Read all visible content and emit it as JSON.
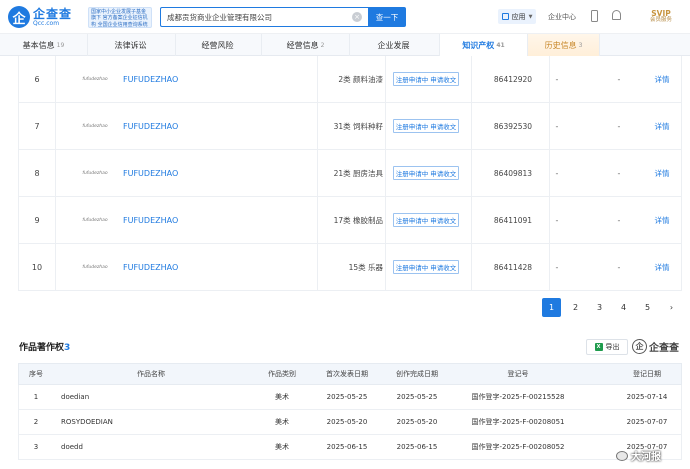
{
  "header": {
    "logo_cn": "企查查",
    "logo_en": "Qcc.com",
    "slogan": "国家中小企业发展子基金旗下 官方备案企业征信机构 全国企业信用查询系统",
    "search_value": "成都贡货商业企业管理有限公司",
    "search_button": "查一下",
    "app_label": "应用",
    "enterprise_center": "企业中心",
    "svip_title": "SVIP",
    "svip_subtitle": "会员服务"
  },
  "tabs": [
    {
      "label": "基本信息",
      "count": "19"
    },
    {
      "label": "法律诉讼",
      "count": ""
    },
    {
      "label": "经营风险",
      "count": ""
    },
    {
      "label": "经营信息",
      "count": "2"
    },
    {
      "label": "企业发展",
      "count": ""
    },
    {
      "label": "知识产权",
      "count": "41"
    },
    {
      "label": "历史信息",
      "count": "3"
    }
  ],
  "trademarks": [
    {
      "no": "6",
      "image_text": "fufudezhao",
      "name": "FUFUDEZHAO",
      "class": "2类 颜料油漆",
      "status": "注册申请中 申请收文",
      "reg_no": "86412920",
      "d1": "-",
      "d2": "-",
      "detail": "详情"
    },
    {
      "no": "7",
      "image_text": "fufudezhao",
      "name": "FUFUDEZHAO",
      "class": "31类 饲料种籽",
      "status": "注册申请中 申请收文",
      "reg_no": "86392530",
      "d1": "-",
      "d2": "-",
      "detail": "详情"
    },
    {
      "no": "8",
      "image_text": "fufudezhao",
      "name": "FUFUDEZHAO",
      "class": "21类 厨房洁具",
      "status": "注册申请中 申请收文",
      "reg_no": "86409813",
      "d1": "-",
      "d2": "-",
      "detail": "详情"
    },
    {
      "no": "9",
      "image_text": "fufudezhao",
      "name": "FUFUDEZHAO",
      "class": "17类 橡胶制品",
      "status": "注册申请中 申请收文",
      "reg_no": "86411091",
      "d1": "-",
      "d2": "-",
      "detail": "详情"
    },
    {
      "no": "10",
      "image_text": "fufudezhao",
      "name": "FUFUDEZHAO",
      "class": "15类 乐器",
      "status": "注册申请中 申请收文",
      "reg_no": "86411428",
      "d1": "-",
      "d2": "-",
      "detail": "详情"
    }
  ],
  "pagination": {
    "pages": [
      "1",
      "2",
      "3",
      "4",
      "5"
    ],
    "current": "1",
    "next": "›"
  },
  "copyright_section": {
    "title": "作品著作权",
    "count": "3",
    "export_label": "导出",
    "brand": "企查查"
  },
  "copyright_table": {
    "headers": {
      "no": "序号",
      "name": "作品名称",
      "type": "作品类别",
      "first": "首次发表日期",
      "done": "创作完成日期",
      "reg": "登记号",
      "date": "登记日期"
    },
    "rows": [
      {
        "no": "1",
        "name": "doedian",
        "type": "美术",
        "first": "2025-05-25",
        "done": "2025-05-25",
        "reg": "国作登字-2025-F-00215528",
        "date": "2025-07-14"
      },
      {
        "no": "2",
        "name": "ROSYDOEDIAN",
        "type": "美术",
        "first": "2025-05-20",
        "done": "2025-05-20",
        "reg": "国作登字-2025-F-00208051",
        "date": "2025-07-07"
      },
      {
        "no": "3",
        "name": "doedd",
        "type": "美术",
        "first": "2025-06-15",
        "done": "2025-06-15",
        "reg": "国作登字-2025-F-00208052",
        "date": "2025-07-07"
      }
    ]
  },
  "watermark": "大河报"
}
